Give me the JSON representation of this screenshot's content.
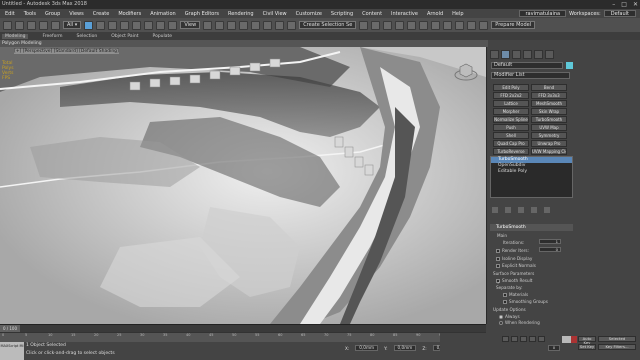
{
  "app": {
    "title": "Untitled - Autodesk 3ds Max 2018",
    "window_buttons": [
      "–",
      "□",
      "✕"
    ]
  },
  "menu": {
    "items": [
      "Edit",
      "Tools",
      "Group",
      "Views",
      "Create",
      "Modifiers",
      "Animation",
      "Graph Editors",
      "Rendering",
      "Civil View",
      "Customize",
      "Scripting",
      "Content",
      "Interactive",
      "Arnold",
      "Help"
    ],
    "user": "ravimatulaina",
    "workspaces_label": "Workspaces:",
    "workspace_value": "Default"
  },
  "toolbar": {
    "view_dropdown": "View",
    "selection_set": "Create Selection Se",
    "prepare_model": "Prepare Model"
  },
  "ribbon": {
    "tabs": [
      "Modeling",
      "Freeform",
      "Selection",
      "Object Paint",
      "Populate"
    ],
    "sub": "Polygon Modeling"
  },
  "viewport": {
    "label": "[+] [Perspective] [Standard] [Default Shading]",
    "stats": [
      "Total",
      "",
      "Polys",
      "",
      "Verts",
      "",
      "FPS"
    ]
  },
  "command_panel": {
    "object_name": "Default",
    "modifier_list": "Modifier List",
    "modifier_buttons": [
      [
        "Edit Poly",
        "Bend"
      ],
      [
        "FFD 2x2x2",
        "FFD 3x3x3"
      ],
      [
        "Lattice",
        "MeshSmooth"
      ],
      [
        "Morpher",
        "Skin Wrap"
      ],
      [
        "Normalize Spline",
        "TurboSmooth"
      ],
      [
        "Push",
        "UVW Map"
      ],
      [
        "Shell",
        "Symmetry"
      ],
      [
        "Quad Cap Pro",
        "Unwrap Pro"
      ],
      [
        "TurboReverse",
        "UVW Mapping Clear"
      ]
    ],
    "stack": [
      "TurboSmooth",
      "OpenSubdiv",
      "Editable Poly"
    ],
    "rollout_title": "TurboSmooth",
    "main_label": "Main",
    "iterations_label": "Iterations:",
    "iterations_value": "1",
    "render_iters_label": "Render Iters:",
    "render_iters_value": "0",
    "isoline_label": "Isoline Display",
    "explicit_normals_label": "Explicit Normals",
    "surface_params_label": "Surface Parameters",
    "smooth_result_label": "Smooth Result",
    "separate_by_label": "Separate by:",
    "materials_label": "Materials",
    "smoothing_groups_label": "Smoothing Groups",
    "update_options_label": "Update Options",
    "always_label": "Always",
    "when_rendering_label": "When Rendering",
    "manually_label": "Manually"
  },
  "timeline": {
    "thumb_label": "0 / 100",
    "ticks": [
      "0",
      "5",
      "10",
      "15",
      "20",
      "25",
      "30",
      "35",
      "40",
      "45",
      "50",
      "55",
      "60",
      "65",
      "70",
      "75",
      "80",
      "85",
      "90",
      "95",
      "100"
    ]
  },
  "status": {
    "left_label": "MAXScript Mi",
    "line1": "1 Object Selected",
    "line2": "Click or click-and-drag to select objects",
    "x_label": "X:",
    "x_value": "0,0mm",
    "y_label": "Y:",
    "y_value": "0,0mm",
    "z_label": "Z:",
    "z_value": "0,0mm",
    "grid": "Grid = 100,0mm",
    "add_time_tag": "Add Time Tag"
  },
  "animation": {
    "auto_key": "Auto Key",
    "selected": "Selected",
    "set_key": "Set Key",
    "key_filters": "Key Filters...",
    "frame_value": "0"
  }
}
